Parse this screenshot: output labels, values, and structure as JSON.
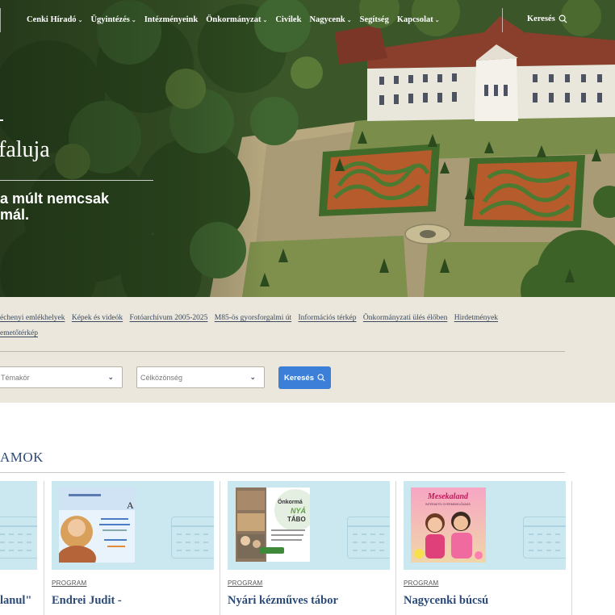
{
  "header": {
    "nav": [
      {
        "label": "Cenki Híradó",
        "has_menu": true
      },
      {
        "label": "Ügyintézés",
        "has_menu": true
      },
      {
        "label": "Intézményeink",
        "has_menu": false
      },
      {
        "label": "Önkormányzat",
        "has_menu": true
      },
      {
        "label": "Civilek",
        "has_menu": false
      },
      {
        "label": "Nagycenk",
        "has_menu": true
      },
      {
        "label": "Segítség",
        "has_menu": false
      },
      {
        "label": "Kapcsolat",
        "has_menu": true
      }
    ],
    "chevron_glyph": "⌄",
    "search_label": "Keresés",
    "search_icon": "search-icon"
  },
  "hero": {
    "title": "faluja",
    "tagline_line1": "a múlt nemcsak",
    "tagline_line2": "mál."
  },
  "quick_links": [
    "échenyi emlékhelyek",
    "Képek és videók",
    "Fotóarchívum 2005-2025",
    "M85-ös gyorsforgalmi út",
    "Információs térkép",
    "Önkormányzati ülés élőben",
    "Hirdetmények",
    "emetőtérkép"
  ],
  "filters": {
    "topic_placeholder": "Témakör",
    "target_placeholder": "Célközönség",
    "search_button": "Keresés",
    "chevron_glyph": "⌄"
  },
  "programs": {
    "section_title": "AMOK",
    "cards": [
      {
        "category": "",
        "title": "lanul\""
      },
      {
        "category": "PROGRAM",
        "title": "Endrei Judit -"
      },
      {
        "category": "PROGRAM",
        "title": "Nyári kézműves tábor"
      },
      {
        "category": "PROGRAM",
        "title": "Nagycenki búcsú"
      }
    ],
    "posters": {
      "nyari_title_1": "Önkormá",
      "nyari_title_2": "NYÁ",
      "nyari_title_3": "TÁBO",
      "mesekaland_title": "Mesekaland",
      "mesekaland_sub": "INTERAKTÍV GYERMEKELŐADÁS"
    }
  },
  "colors": {
    "accent_blue": "#3c7fd8",
    "heading_blue": "#2c4a78",
    "band_bg": "#ebe7dc",
    "card_bg": "#cbe7ef"
  }
}
